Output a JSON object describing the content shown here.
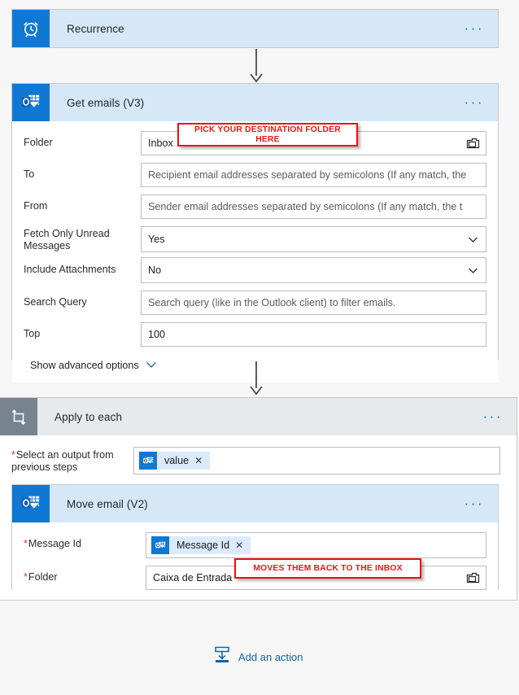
{
  "flow": {
    "steps": [
      {
        "id": "recurrence",
        "title": "Recurrence",
        "icon": "alarm-clock-icon",
        "more_label": "···"
      },
      {
        "id": "get-emails",
        "title": "Get emails (V3)",
        "icon": "outlook-icon",
        "more_label": "···",
        "fields": [
          {
            "label": "Folder",
            "value": "Inbox",
            "type": "folderpicker"
          },
          {
            "label": "To",
            "placeholder": "Recipient email addresses separated by semicolons (If any match, the",
            "type": "text"
          },
          {
            "label": "From",
            "placeholder": "Sender email addresses separated by semicolons (If any match, the t",
            "type": "text"
          },
          {
            "label": "Fetch Only Unread Messages",
            "value": "Yes",
            "type": "dropdown"
          },
          {
            "label": "Include Attachments",
            "value": "No",
            "type": "dropdown"
          },
          {
            "label": "Search Query",
            "placeholder": "Search query (like in the Outlook client) to filter emails.",
            "type": "text"
          },
          {
            "label": "Top",
            "value": "100",
            "type": "text"
          }
        ],
        "advanced_label": "Show advanced options"
      },
      {
        "id": "apply-to-each",
        "title": "Apply to each",
        "icon": "loop-icon",
        "more_label": "···",
        "select_output": {
          "label": "Select an output from previous steps",
          "required": true,
          "token": {
            "text": "value",
            "icon": "outlook-icon",
            "remove_label": "✕"
          }
        }
      },
      {
        "id": "move-email",
        "title": "Move email (V2)",
        "icon": "outlook-icon",
        "more_label": "···",
        "fields": [
          {
            "label": "Message Id",
            "required": true,
            "type": "token",
            "token": {
              "text": "Message Id",
              "icon": "outlook-icon",
              "remove_label": "✕"
            }
          },
          {
            "label": "Folder",
            "required": true,
            "value": "Caixa de Entrada",
            "type": "folderpicker"
          }
        ]
      }
    ],
    "add_action": {
      "label": "Add an action",
      "icon": "add-action-icon"
    }
  },
  "annotations": [
    {
      "id": "anno-destination-folder",
      "text": "PICK YOUR DESTINATION FOLDER HERE"
    },
    {
      "id": "anno-back-to-inbox",
      "text": "MOVES THEM BACK TO THE INBOX"
    }
  ],
  "colors": {
    "accent_blue": "#0f78d4",
    "header_blue": "#d6e8f7",
    "header_gray": "#e6eaed",
    "loop_icon_gray": "#77838f",
    "annotation_red": "#ee1111",
    "link_blue": "#1264a3",
    "canvas": "#f6f6f6"
  }
}
